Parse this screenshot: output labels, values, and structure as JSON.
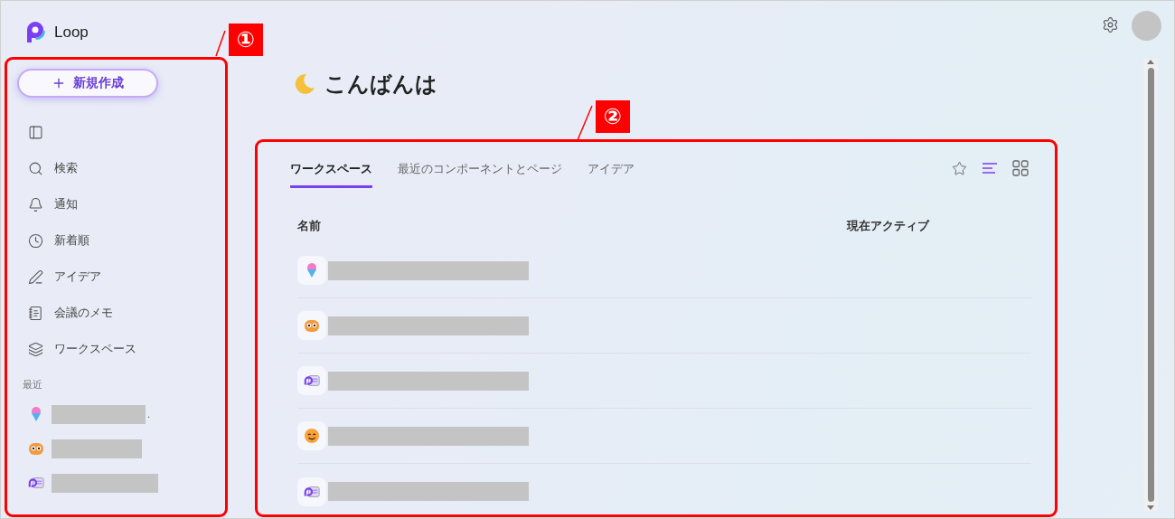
{
  "app": {
    "name": "Loop"
  },
  "sidebar": {
    "new_button": {
      "label": "新規作成"
    },
    "nav": [
      {
        "kind": "collapse"
      },
      {
        "kind": "search",
        "label": "検索"
      },
      {
        "kind": "notifications",
        "label": "通知"
      },
      {
        "kind": "recent",
        "label": "新着順"
      },
      {
        "kind": "ideas",
        "label": "アイデア"
      },
      {
        "kind": "notes",
        "label": "会議のメモ"
      },
      {
        "kind": "workspaces",
        "label": "ワークスペース"
      }
    ],
    "recent_heading": "最近",
    "recent": [
      {
        "kind": "shaved-ice",
        "name_redacted": true,
        "suffix": "."
      },
      {
        "kind": "owl",
        "name_redacted": true
      },
      {
        "kind": "loop-page",
        "name_redacted": true
      }
    ]
  },
  "greeting": "こんばんは",
  "tabs": [
    {
      "label": "ワークスペース",
      "selected": true
    },
    {
      "label": "最近のコンポーネントとページ",
      "selected": false
    },
    {
      "label": "アイデア",
      "selected": false
    }
  ],
  "views": [
    {
      "kind": "list",
      "selected": true
    },
    {
      "kind": "grid",
      "selected": false
    }
  ],
  "table": {
    "columns": [
      "名前",
      "現在アクティブ"
    ],
    "rows": [
      {
        "kind": "shaved-ice",
        "name_redacted": true
      },
      {
        "kind": "owl",
        "name_redacted": true
      },
      {
        "kind": "loop-page",
        "name_redacted": true
      },
      {
        "kind": "smile",
        "name_redacted": true
      },
      {
        "kind": "loop-page",
        "name_redacted": true
      }
    ]
  },
  "annotations": [
    {
      "label": "①"
    },
    {
      "label": "②"
    }
  ]
}
